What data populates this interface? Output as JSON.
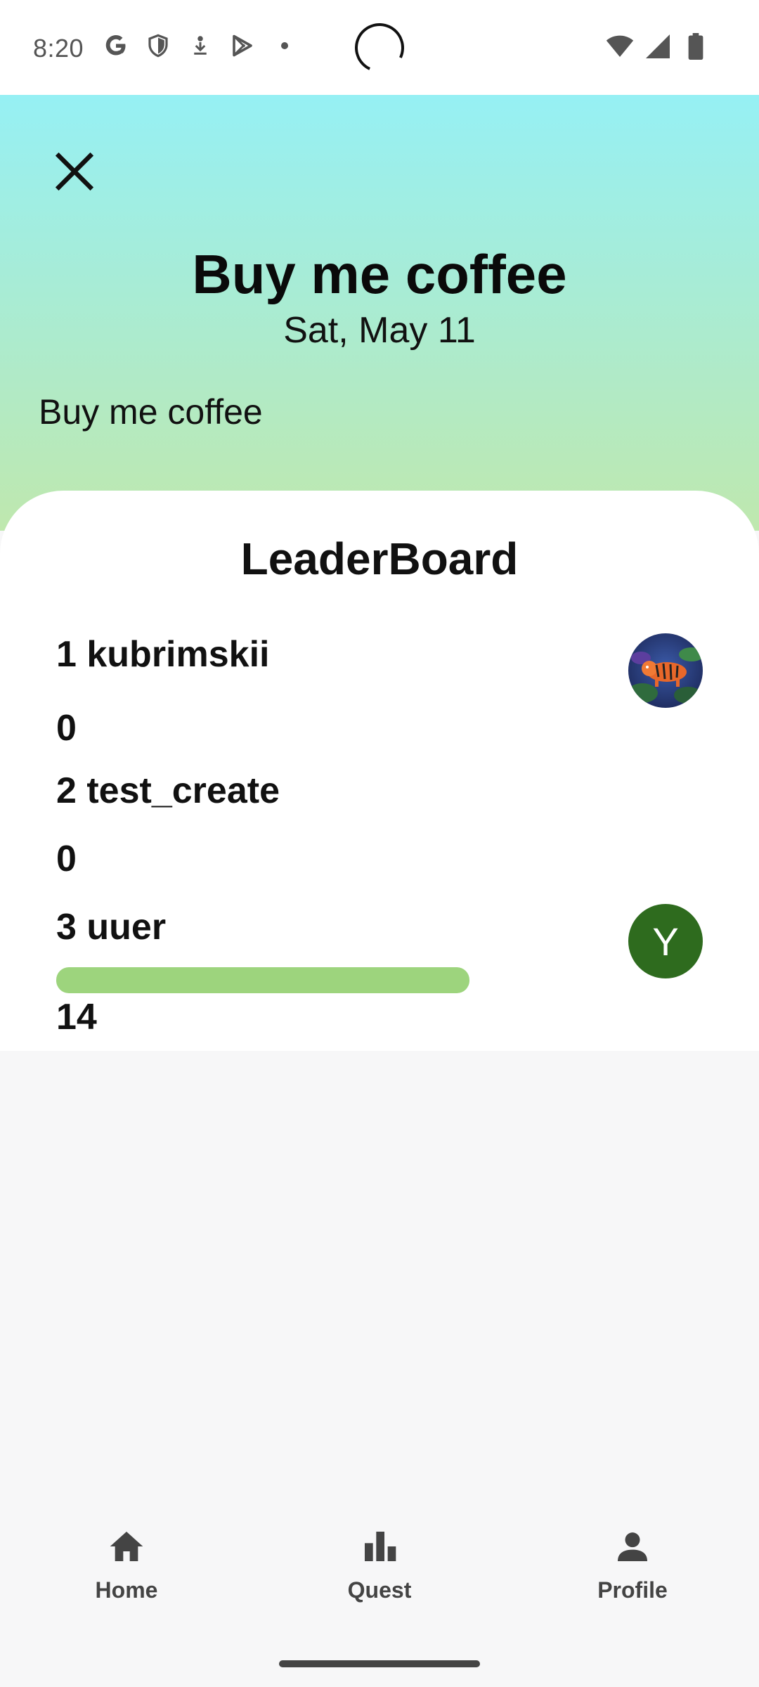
{
  "status_bar": {
    "time": "8:20",
    "left_icons": [
      "google-icon",
      "shield-icon",
      "download-icon",
      "play-store-icon",
      "dot-icon"
    ],
    "right_icons": [
      "wifi-icon",
      "signal-icon",
      "battery-icon"
    ]
  },
  "header": {
    "title": "Buy me coffee",
    "date": "Sat, May 11",
    "description": "Buy me coffee",
    "gradient_top": "#96f0f4",
    "gradient_bottom": "#bfe8ae"
  },
  "leaderboard": {
    "title": "LeaderBoard",
    "entries": [
      {
        "label": "1 kubrimskii",
        "score": "0",
        "avatar": "tiger-image",
        "progress": 0
      },
      {
        "label": "2 test_create",
        "score": "0",
        "avatar": "",
        "progress": 0
      },
      {
        "label": "3 uuer",
        "score": "14",
        "avatar_letter": "Y",
        "avatar_color": "#2e6b1e",
        "progress": 1.0
      }
    ],
    "progress_color": "#9dd47d"
  },
  "nav": {
    "items": [
      {
        "label": "Home",
        "icon": "home-icon"
      },
      {
        "label": "Quest",
        "icon": "bar-chart-icon"
      },
      {
        "label": "Profile",
        "icon": "person-icon"
      }
    ]
  }
}
